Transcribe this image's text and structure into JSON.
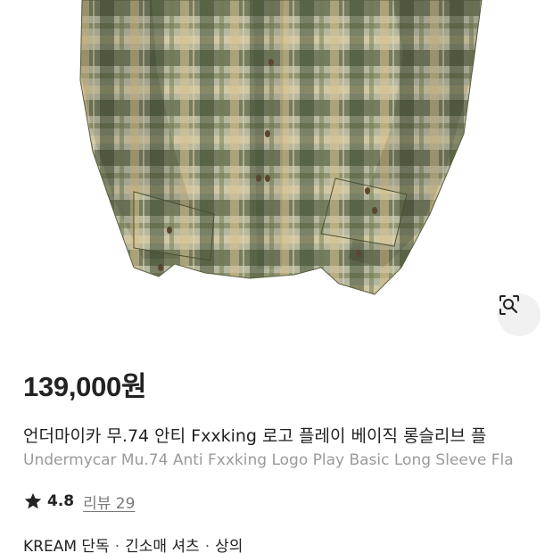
{
  "product": {
    "image_icon": "plaid-flannel-shirt",
    "image_colors": {
      "base": "#b7b8a1",
      "dark": "#3d4a2c",
      "mid": "#6f7a4e",
      "light": "#e1d2a6",
      "cream": "#d9c08a"
    },
    "lens_icon": "image-search-icon",
    "price": "139,000원",
    "title_ko": "언더마이카 무.74 안티 Fxxking 로고 플레이 베이직 롱슬리브 플",
    "title_en": "Undermycar Mu.74 Anti Fxxking Logo Play Basic Long Sleeve Fla",
    "rating": {
      "icon": "star-icon",
      "value": "4.8",
      "review_link": "리뷰 29"
    },
    "categories": [
      "KREAM 단독",
      "긴소매 셔츠",
      "상의"
    ],
    "category_separator": "·"
  }
}
